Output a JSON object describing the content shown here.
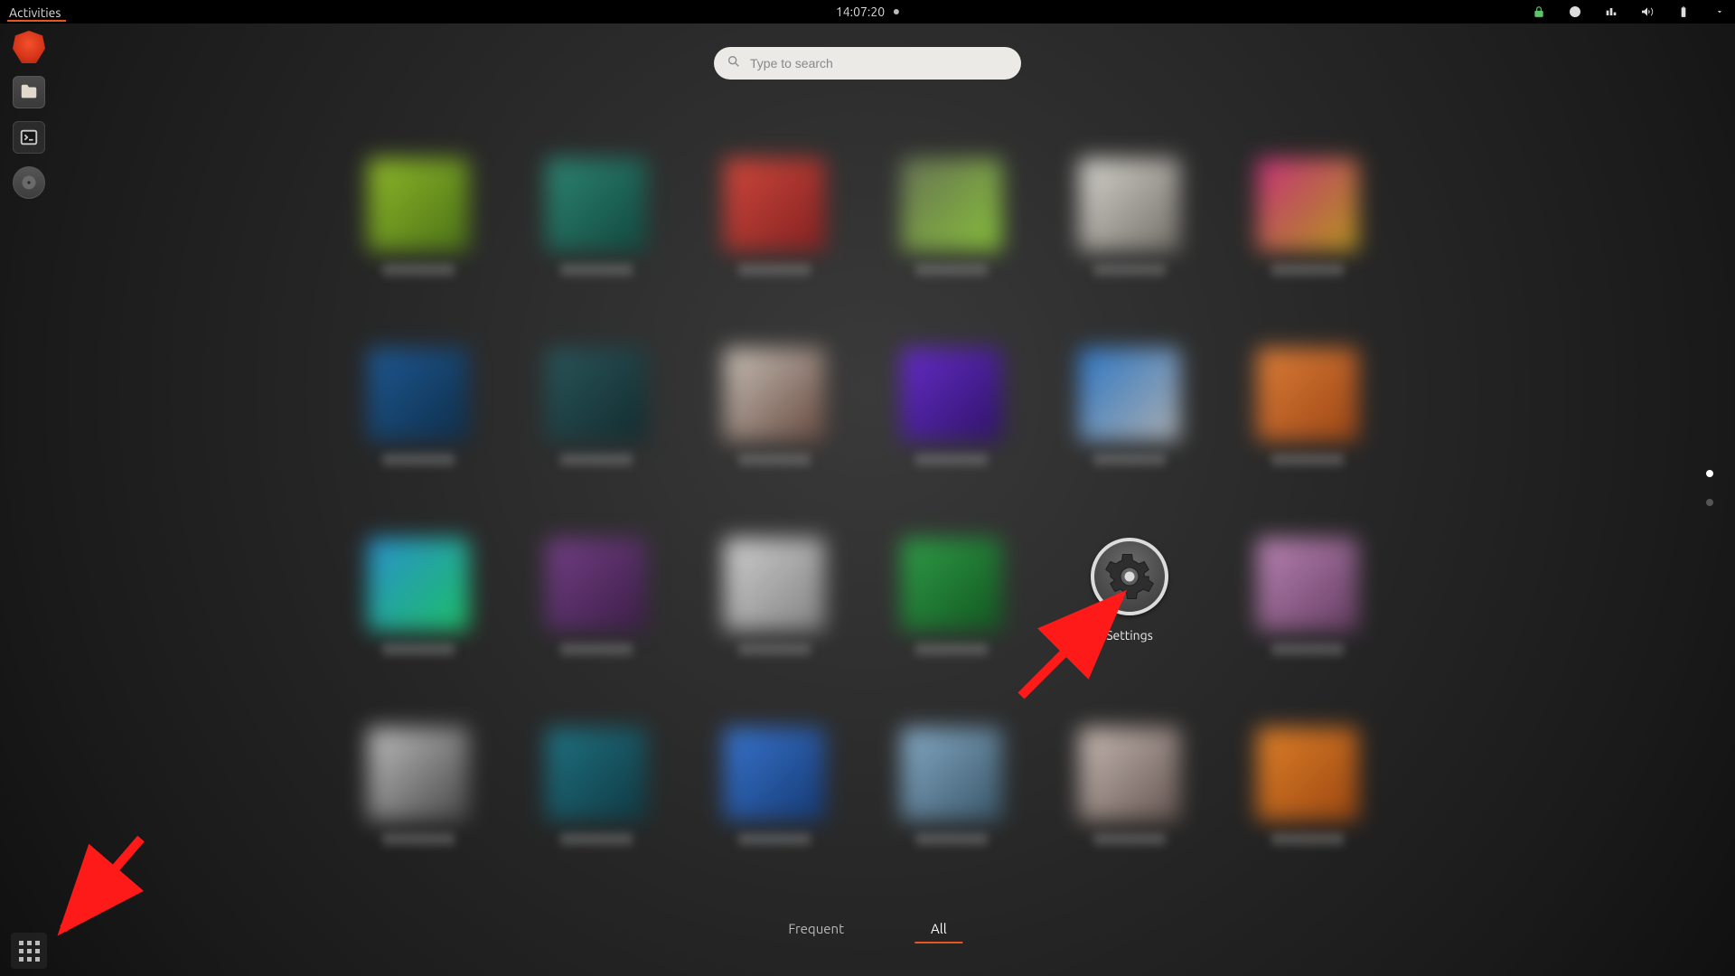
{
  "topbar": {
    "activities_label": "Activities",
    "clock": "14:07:20"
  },
  "tray": {
    "icons": [
      "lock-icon",
      "chat-icon",
      "network-icon",
      "volume-icon",
      "battery-icon",
      "caret-down-icon"
    ]
  },
  "search": {
    "placeholder": "Type to search"
  },
  "dock": {
    "apps": [
      "Brave",
      "Files",
      "Terminal",
      "Disks"
    ],
    "show_apps_tooltip": "Show Applications"
  },
  "grid": {
    "columns": 6,
    "rows": 4,
    "apps": [
      {
        "label": "",
        "blurred": true,
        "color_a": "#9ac72a",
        "color_b": "#4e7a14"
      },
      {
        "label": "",
        "blurred": true,
        "color_a": "#2e8f7a",
        "color_b": "#0d4a3f"
      },
      {
        "label": "",
        "blurred": true,
        "color_a": "#e04b3e",
        "color_b": "#8b1e1e"
      },
      {
        "label": "",
        "blurred": true,
        "color_a": "#6f7a5a",
        "color_b": "#8fcf3a"
      },
      {
        "label": "",
        "blurred": true,
        "color_a": "#e8e6df",
        "color_b": "#7a766e"
      },
      {
        "label": "",
        "blurred": true,
        "color_a": "#d63384",
        "color_b": "#c4a21a"
      },
      {
        "label": "",
        "blurred": true,
        "color_a": "#1d5e9e",
        "color_b": "#0b2e4d"
      },
      {
        "label": "",
        "blurred": true,
        "color_a": "#2a5a60",
        "color_b": "#0e2b2e"
      },
      {
        "label": "",
        "blurred": true,
        "color_a": "#d8cfc5",
        "color_b": "#6b4a3e"
      },
      {
        "label": "",
        "blurred": true,
        "color_a": "#6a2bd8",
        "color_b": "#2e0f6e"
      },
      {
        "label": "",
        "blurred": true,
        "color_a": "#2d7fd6",
        "color_b": "#b9bcbe"
      },
      {
        "label": "",
        "blurred": true,
        "color_a": "#f0873a",
        "color_b": "#a84812"
      },
      {
        "label": "",
        "blurred": true,
        "color_a": "#2a9de0",
        "color_b": "#1bd06e"
      },
      {
        "label": "",
        "blurred": true,
        "color_a": "#7a418e",
        "color_b": "#3d1c4a"
      },
      {
        "label": "",
        "blurred": true,
        "color_a": "#e0e0e0",
        "color_b": "#8a8a8a"
      },
      {
        "label": "",
        "blurred": true,
        "color_a": "#2fa84a",
        "color_b": "#0e5a1e"
      },
      {
        "label": "Settings",
        "blurred": false,
        "icon": "settings-gear"
      },
      {
        "label": "",
        "blurred": true,
        "color_a": "#c98fc2",
        "color_b": "#6b3e68"
      },
      {
        "label": "",
        "blurred": true,
        "color_a": "#cfcfcf",
        "color_b": "#4a4a4a"
      },
      {
        "label": "",
        "blurred": true,
        "color_a": "#1f7a8c",
        "color_b": "#0c3a44"
      },
      {
        "label": "",
        "blurred": true,
        "color_a": "#3a7de0",
        "color_b": "#123a7a"
      },
      {
        "label": "",
        "blurred": true,
        "color_a": "#8fb8d6",
        "color_b": "#3a5a70"
      },
      {
        "label": "",
        "blurred": true,
        "color_a": "#d8c9c2",
        "color_b": "#6b5a54"
      },
      {
        "label": "",
        "blurred": true,
        "color_a": "#f28a2a",
        "color_b": "#a84a0e"
      }
    ]
  },
  "tabs": {
    "frequent": "Frequent",
    "all": "All",
    "active": "all"
  },
  "pages": {
    "count": 2,
    "active": 0
  },
  "annotations": {
    "arrow_to_settings": true,
    "arrow_to_show_apps": true
  },
  "colors": {
    "accent": "#e95420"
  }
}
